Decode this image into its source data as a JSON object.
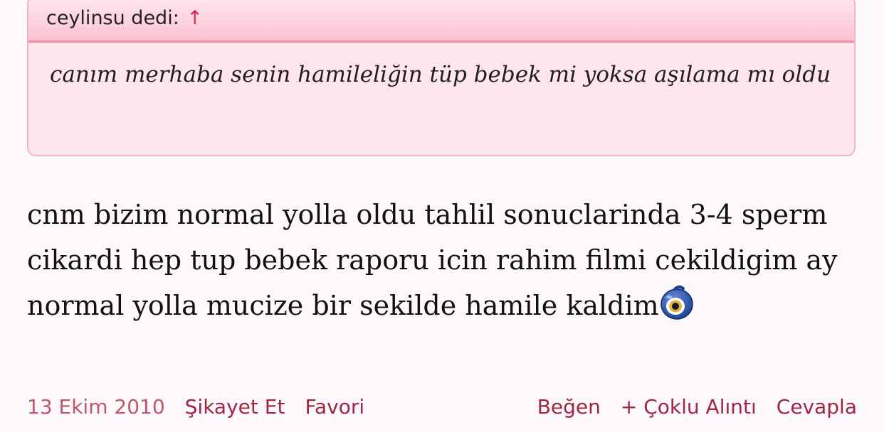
{
  "quote": {
    "author_label": "ceylinsu dedi:",
    "arrow": "↑",
    "text": "canım merhaba senin hamileliğin tüp bebek mi yoksa aşılama mı oldu"
  },
  "post": {
    "text": "cnm bizim normal yolla oldu tahlil sonuclarinda 3-4 sperm cikardi hep tup bebek raporu icin rahim filmi cekildigim ay normal yolla mucize bir sekilde hamile kaldim",
    "emoji_icon": "nazar-boncugu-icon"
  },
  "footer": {
    "date": "13 Ekim 2010",
    "report": "Şikayet Et",
    "favorite": "Favori",
    "like": "Beğen",
    "multi_quote": "+ Çoklu Alıntı",
    "reply": "Cevapla"
  },
  "colors": {
    "accent": "#a0273f",
    "quote_bg": "#ffe6ec",
    "quote_border": "#ef8aa7"
  }
}
